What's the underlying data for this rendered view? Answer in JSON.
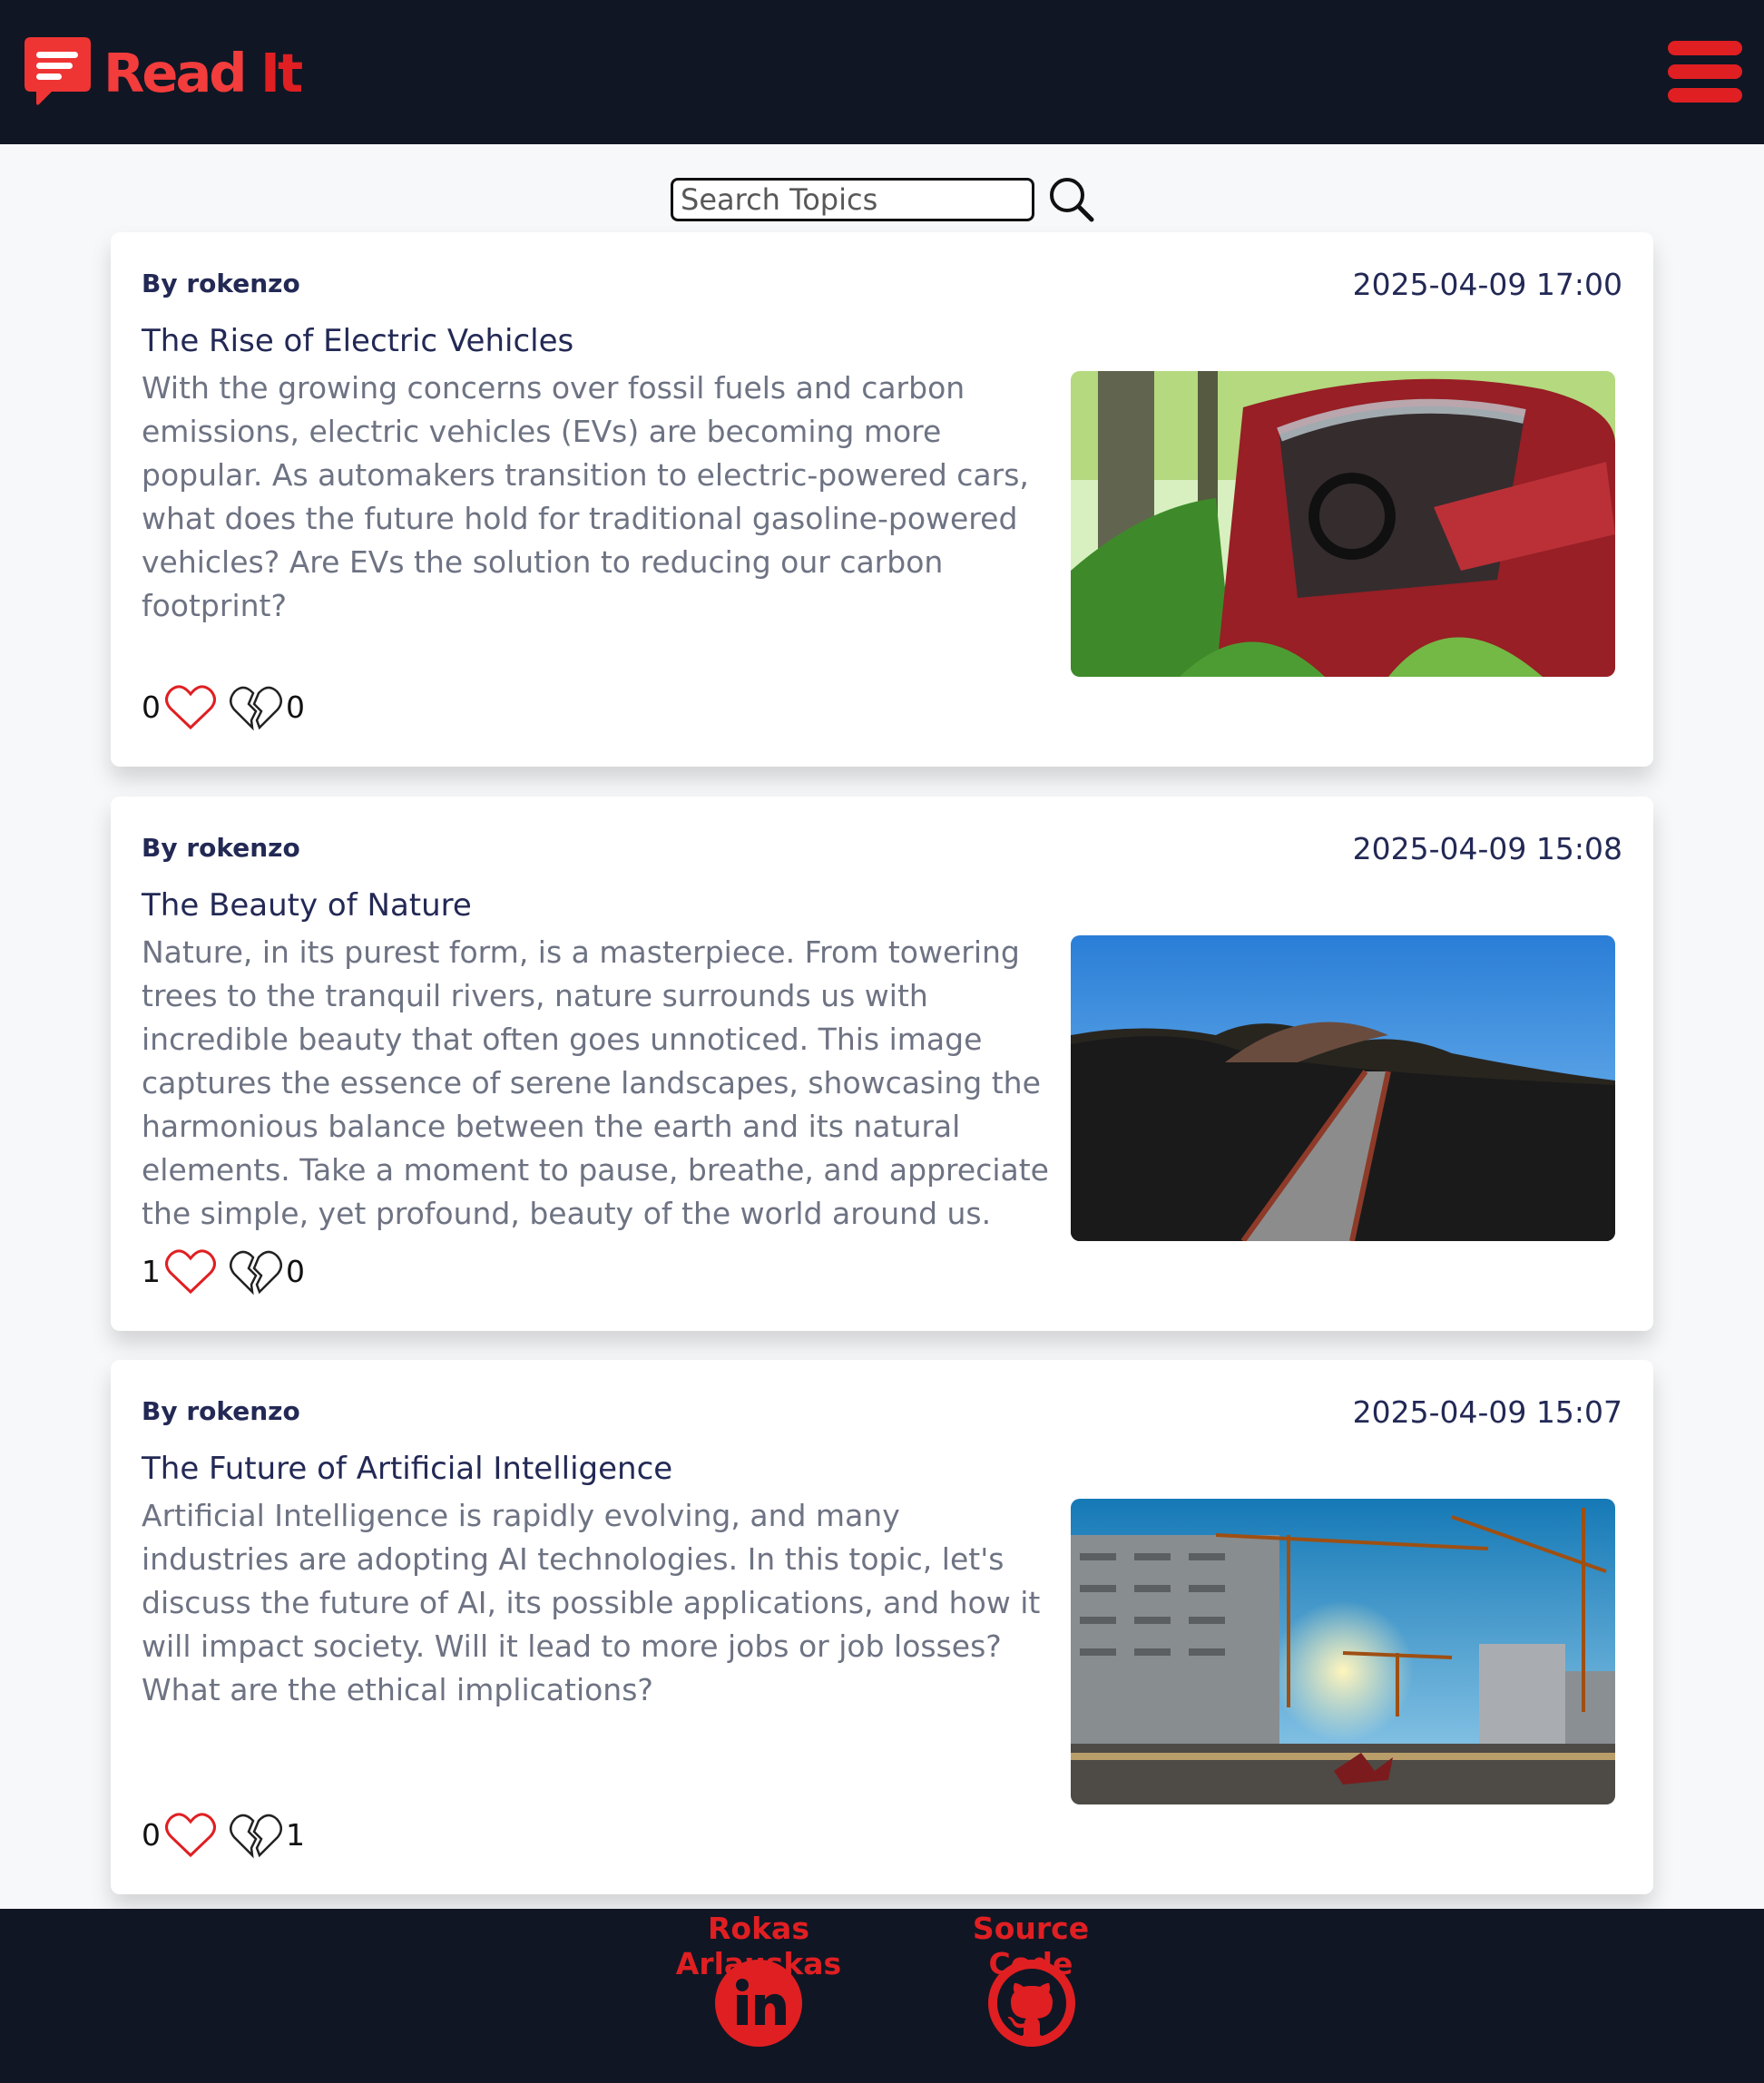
{
  "header": {
    "logo_text_first": "Read",
    "logo_text_second": "It"
  },
  "search": {
    "placeholder": "Search Topics",
    "value": ""
  },
  "posts": [
    {
      "author": "By rokenzo",
      "date": "2025-04-09 17:00",
      "title": "The Rise of Electric Vehicles",
      "body": "With the growing concerns over fossil fuels and carbon emissions, electric vehicles (EVs) are becoming more popular. As automakers transition to electric-powered cars, what does the future hold for traditional gasoline-powered vehicles? Are EVs the solution to reducing our carbon footprint?",
      "likes": "0",
      "dislikes": "0"
    },
    {
      "author": "By rokenzo",
      "date": "2025-04-09 15:08",
      "title": "The Beauty of Nature",
      "body": "Nature, in its purest form, is a masterpiece. From towering trees to the tranquil rivers, nature surrounds us with incredible beauty that often goes unnoticed. This image captures the essence of serene landscapes, showcasing the harmonious balance between the earth and its natural elements. Take a moment to pause, breathe, and appreciate the simple, yet profound, beauty of the world around us.",
      "likes": "1",
      "dislikes": "0"
    },
    {
      "author": "By rokenzo",
      "date": "2025-04-09 15:07",
      "title": "The Future of Artificial Intelligence",
      "body": "Artificial Intelligence is rapidly evolving, and many industries are adopting AI technologies. In this topic, let's discuss the future of AI, its possible applications, and how it will impact society. Will it lead to more jobs or job losses? What are the ethical implications?",
      "likes": "0",
      "dislikes": "1"
    }
  ],
  "footer": {
    "author_link": "Rokas Arlauskas",
    "source_link": "Source Code"
  },
  "colors": {
    "brand_red": "#e01f22",
    "header_bg": "#101624",
    "text_navy": "#232955",
    "body_gray": "#6e7383"
  },
  "icons": [
    "chat-logo-icon",
    "hamburger-menu-icon",
    "search-icon",
    "heart-icon",
    "broken-heart-icon",
    "linkedin-icon",
    "github-icon"
  ]
}
